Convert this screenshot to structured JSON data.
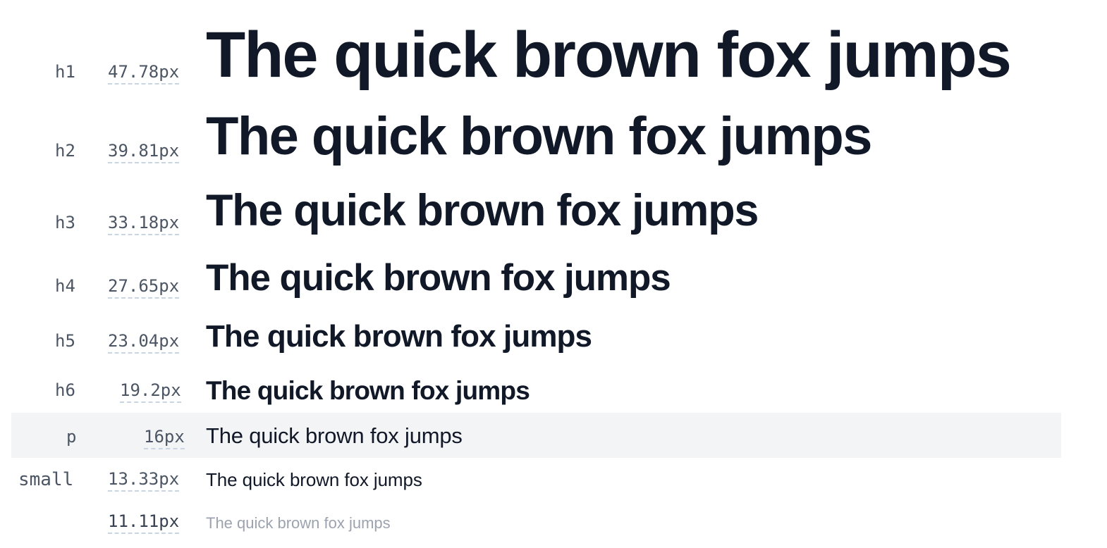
{
  "rows": [
    {
      "tag": "h1",
      "size": "47.78px",
      "sample": "The quick brown fox jumps"
    },
    {
      "tag": "h2",
      "size": "39.81px",
      "sample": "The quick brown fox jumps"
    },
    {
      "tag": "h3",
      "size": "33.18px",
      "sample": "The quick brown fox jumps"
    },
    {
      "tag": "h4",
      "size": "27.65px",
      "sample": "The quick brown fox jumps"
    },
    {
      "tag": "h5",
      "size": "23.04px",
      "sample": "The quick brown fox jumps"
    },
    {
      "tag": "h6",
      "size": "19.2px",
      "sample": "The quick brown fox jumps"
    },
    {
      "tag": "p",
      "size": "16px",
      "sample": "The quick brown fox jumps"
    },
    {
      "tag": "small",
      "size": "13.33px",
      "sample": "The quick brown fox jumps"
    },
    {
      "tag": "",
      "size": "11.11px",
      "sample": "The quick brown fox jumps"
    }
  ],
  "colors": {
    "text": "#111827",
    "muted": "#4b5563",
    "faint": "#9ca3af",
    "highlight": "#f3f4f6",
    "dash": "#cbd5e1"
  }
}
